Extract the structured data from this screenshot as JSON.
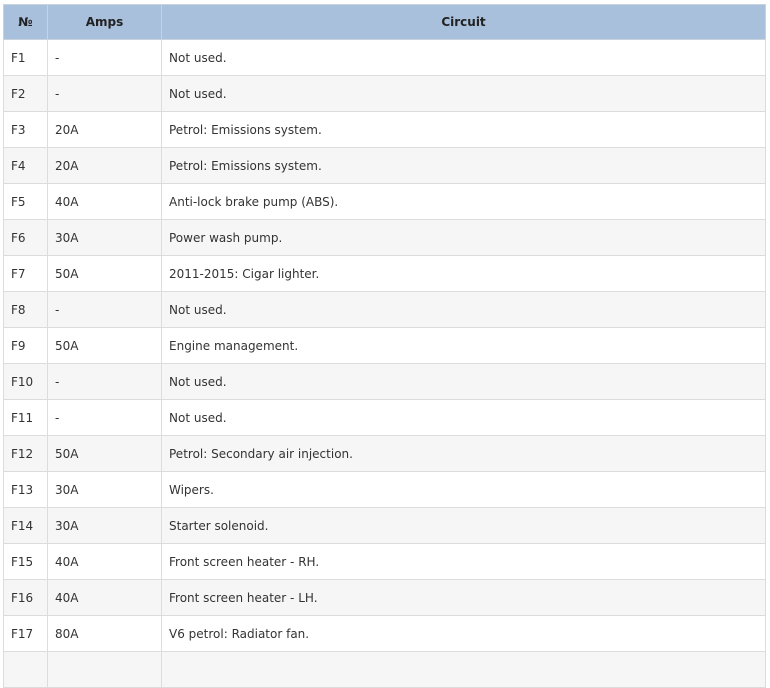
{
  "table": {
    "headers": [
      "№",
      "Amps",
      "Circuit"
    ],
    "rows": [
      [
        "F1",
        "-",
        "Not used."
      ],
      [
        "F2",
        "-",
        "Not used."
      ],
      [
        "F3",
        "20A",
        "Petrol: Emissions system."
      ],
      [
        "F4",
        "20A",
        "Petrol: Emissions system."
      ],
      [
        "F5",
        "40A",
        "Anti-lock brake pump (ABS)."
      ],
      [
        "F6",
        "30A",
        "Power wash pump."
      ],
      [
        "F7",
        "50A",
        "2011-2015: Cigar lighter."
      ],
      [
        "F8",
        "-",
        "Not used."
      ],
      [
        "F9",
        "50A",
        "Engine management."
      ],
      [
        "F10",
        "-",
        "Not used."
      ],
      [
        "F11",
        "-",
        "Not used."
      ],
      [
        "F12",
        "50A",
        "Petrol: Secondary air injection."
      ],
      [
        "F13",
        "30A",
        "Wipers."
      ],
      [
        "F14",
        "30A",
        "Starter solenoid."
      ],
      [
        "F15",
        "40A",
        "Front screen heater - RH."
      ],
      [
        "F16",
        "40A",
        "Front screen heater - LH."
      ],
      [
        "F17",
        "80A",
        "V6 petrol: Radiator fan."
      ],
      [
        "",
        "",
        ""
      ]
    ]
  },
  "colors": {
    "header_bg": "#a9c0dd",
    "row_alt_bg": "#f6f6f6",
    "border": "#dcdcdc"
  }
}
